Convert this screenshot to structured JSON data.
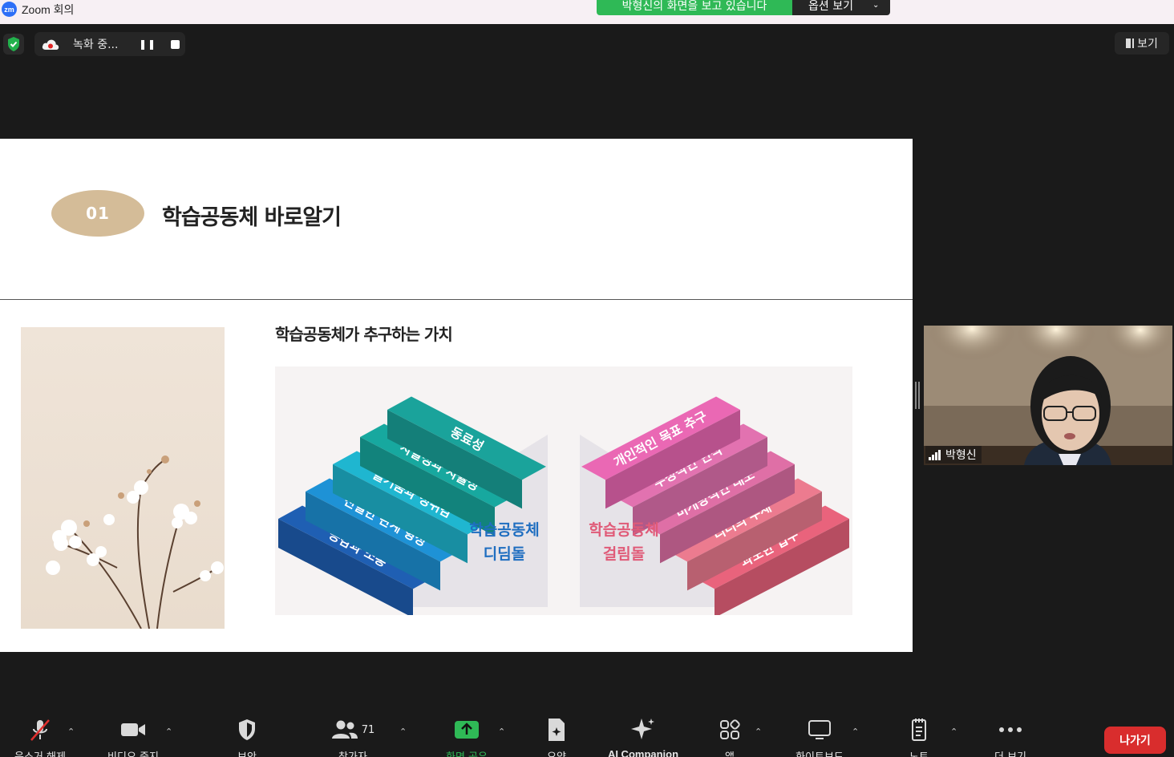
{
  "window": {
    "logo_text": "zm",
    "title": "Zoom 회의"
  },
  "share_banner": {
    "text": "박형신의 화면을 보고 있습니다",
    "options_label": "옵션 보기"
  },
  "recording": {
    "status": "녹화 중..."
  },
  "view": {
    "label": "보기"
  },
  "slide": {
    "badge": "01",
    "title": "학습공동체 바로알기",
    "subtitle": "학습공동체가 추구하는 가치",
    "left_stairs": {
      "caption_line1": "학습공동체",
      "caption_line2": "디딤돌",
      "steps": [
        "동료성",
        "자발성과 자율성",
        "즐거움과 성취감",
        "친밀한 관계 형성",
        "공감과 소통"
      ],
      "colors": [
        "#1aa39b",
        "#17a89f",
        "#1fb6d0",
        "#1e92d6",
        "#1f5fb3"
      ]
    },
    "right_stairs": {
      "caption_line1": "학습공동체",
      "caption_line2": "걸림돌",
      "steps": [
        "개인적인 목표 추구",
        "부정적인 인식",
        "비개방적인 태도",
        "리더의 부재",
        "과도한 업무"
      ],
      "colors": [
        "#ea68b4",
        "#e272b0",
        "#df6fa6",
        "#ec7b8f",
        "#e9637c"
      ]
    }
  },
  "participant_video": {
    "name": "박형신"
  },
  "toolbar": {
    "items": [
      {
        "label": "음소거 해제",
        "icon": "muted-mic-icon"
      },
      {
        "label": "비디오 중지",
        "icon": "video-camera-icon"
      },
      {
        "label": "보안",
        "icon": "security-shield-icon"
      },
      {
        "label": "참가자",
        "icon": "participants-icon",
        "count": "71"
      },
      {
        "label": "화면 공유",
        "icon": "share-screen-icon"
      },
      {
        "label": "요약",
        "icon": "summary-doc-icon"
      },
      {
        "label": "AI Companion",
        "icon": "ai-sparkle-icon"
      },
      {
        "label": "앱",
        "icon": "apps-icon"
      },
      {
        "label": "화이트보드",
        "icon": "whiteboard-icon"
      },
      {
        "label": "노트",
        "icon": "notes-icon"
      },
      {
        "label": "더 보기",
        "icon": "more-dots-icon"
      }
    ],
    "leave_label": "나가기"
  },
  "colors": {
    "share_green": "#2fb956",
    "leave_red": "#d92d2d",
    "badge_tan": "#d4bc98",
    "caption_blue": "#1f6ec0",
    "caption_pink": "#e05b78"
  }
}
